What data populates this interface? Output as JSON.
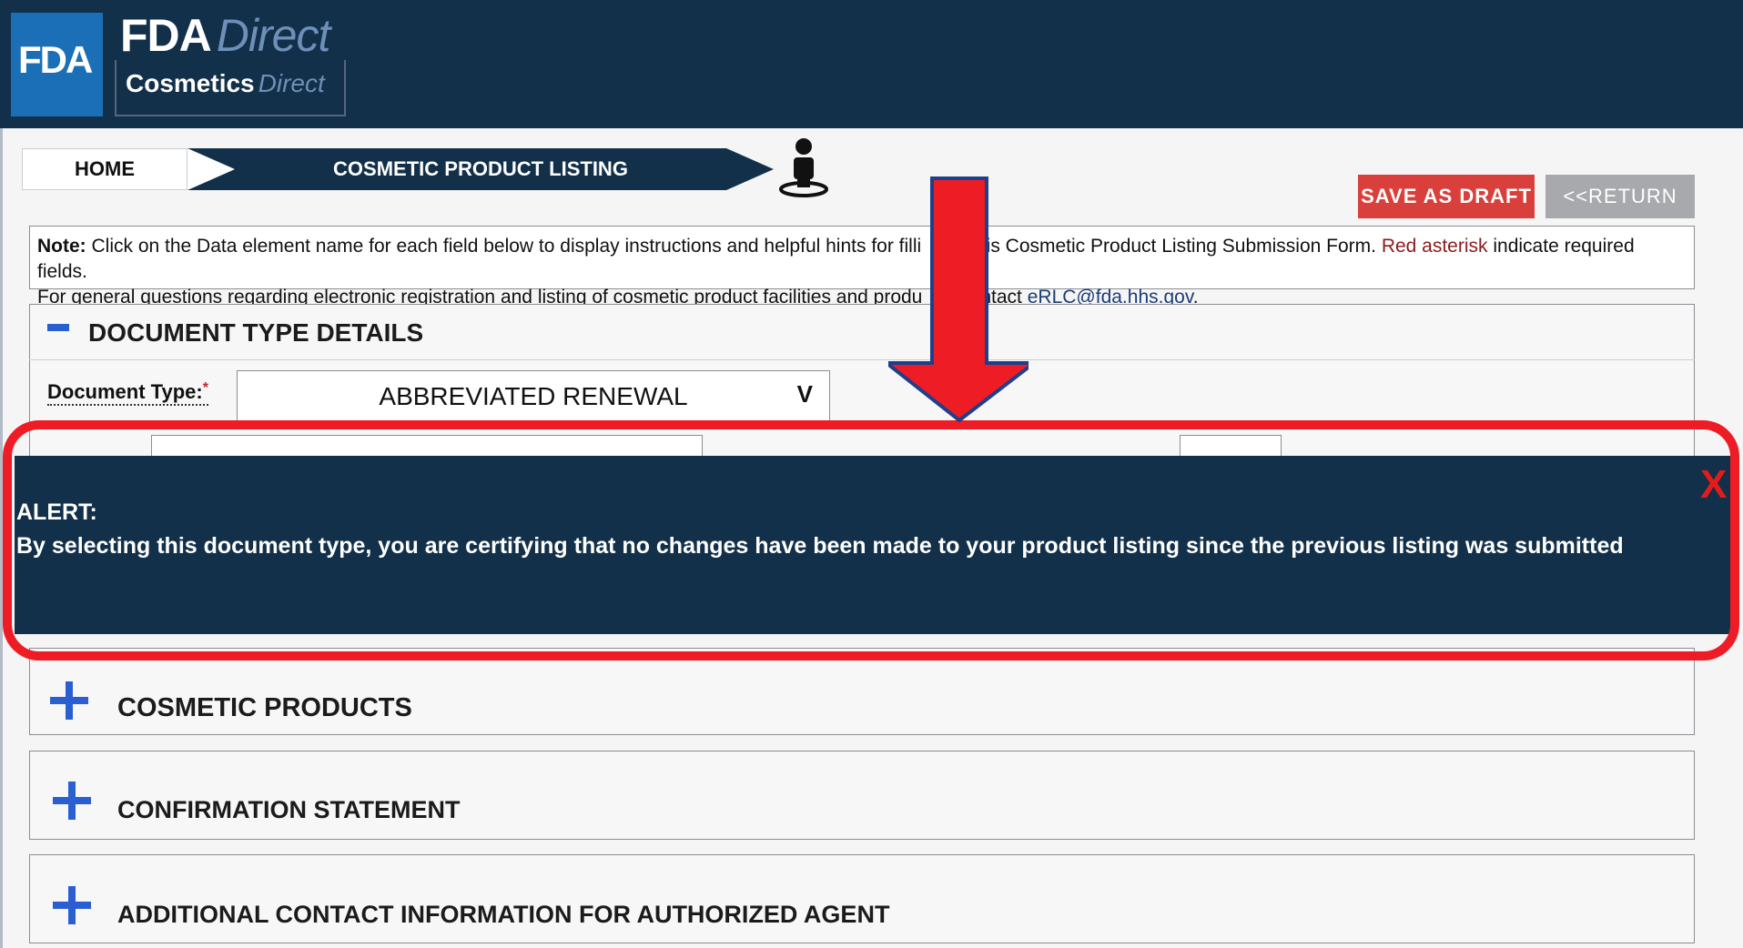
{
  "header": {
    "fda_logo": "FDA",
    "brand_title": "FDA",
    "brand_title_accent": "Direct",
    "brand_subtitle": "Cosmetics",
    "brand_subtitle_accent": "Direct"
  },
  "breadcrumb": {
    "home": "HOME",
    "current": "COSMETIC PRODUCT LISTING"
  },
  "toolbar": {
    "save_draft": "SAVE AS DRAFT",
    "return": "<<RETURN"
  },
  "note": {
    "label": "Note:",
    "text1": " Click on the Data element name for each field below to display instructions and helpful hints for filli",
    "text2": "this Cosmetic Product Listing Submission Form. ",
    "red_text": "Red asterisk",
    "text3": " indicate required fields.",
    "line2a": "For general questions regarding electronic registration and listing of cosmetic product facilities and produ",
    "line2b": "ntact ",
    "email": "eRLC@fda.hhs.gov",
    "line2c": "."
  },
  "document_type_section": {
    "title": "DOCUMENT TYPE DETAILS",
    "document_type_label": "Document Type:",
    "document_type_value": "ABBREVIATED RENEWAL",
    "required_mark": "*"
  },
  "alert": {
    "title": "ALERT:",
    "message": "By selecting this document type, you are certifying that no changes have been made to your product listing since the previous listing was submitted",
    "close": "X"
  },
  "sections": [
    {
      "title": "COSMETIC PRODUCTS"
    },
    {
      "title": "CONFIRMATION STATEMENT"
    },
    {
      "title": "ADDITIONAL CONTACT INFORMATION FOR AUTHORIZED AGENT"
    }
  ],
  "colors": {
    "header_bg": "#12304a",
    "accent_blue": "#2b5fd1",
    "save_red": "#d9403c",
    "annotation_red": "#ee1c25"
  }
}
